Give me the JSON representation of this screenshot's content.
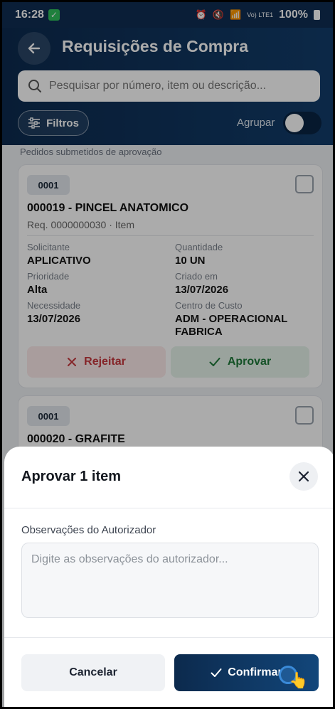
{
  "status_bar": {
    "time": "16:28",
    "signal_text": "Vo) LTE1",
    "battery_percent": "100%"
  },
  "header": {
    "title": "Requisições de Compra",
    "search_placeholder": "Pesquisar por número, item ou descrição...",
    "filters_label": "Filtros",
    "group_label": "Agrupar",
    "group_enabled": false
  },
  "section_caption": "Pedidos submetidos de aprovação",
  "cards": [
    {
      "code": "0001",
      "title": "000019 - PINCEL ANATOMICO",
      "subtitle": "Req. 0000000030 · Item",
      "fields": {
        "solicitante_label": "Solicitante",
        "solicitante": "APLICATIVO",
        "quantidade_label": "Quantidade",
        "quantidade": "10 UN",
        "prioridade_label": "Prioridade",
        "prioridade": "Alta",
        "criado_label": "Criado em",
        "criado": "13/07/2026",
        "necessidade_label": "Necessidade",
        "necessidade": "13/07/2026",
        "centro_label": "Centro de Custo",
        "centro": "ADM - OPERACIONAL FABRICA"
      },
      "reject_label": "Rejeitar",
      "approve_label": "Aprovar"
    },
    {
      "code": "0001",
      "title": "000020 - GRAFITE"
    }
  ],
  "sheet": {
    "title": "Aprovar 1 item",
    "obs_label": "Observações do Autorizador",
    "obs_placeholder": "Digite as observações do autorizador...",
    "cancel_label": "Cancelar",
    "confirm_label": "Confirmar"
  },
  "colors": {
    "header": "#0f2d52",
    "reject": "#c7383e",
    "approve": "#1e7a3a",
    "confirm": "#0c2a4d"
  }
}
